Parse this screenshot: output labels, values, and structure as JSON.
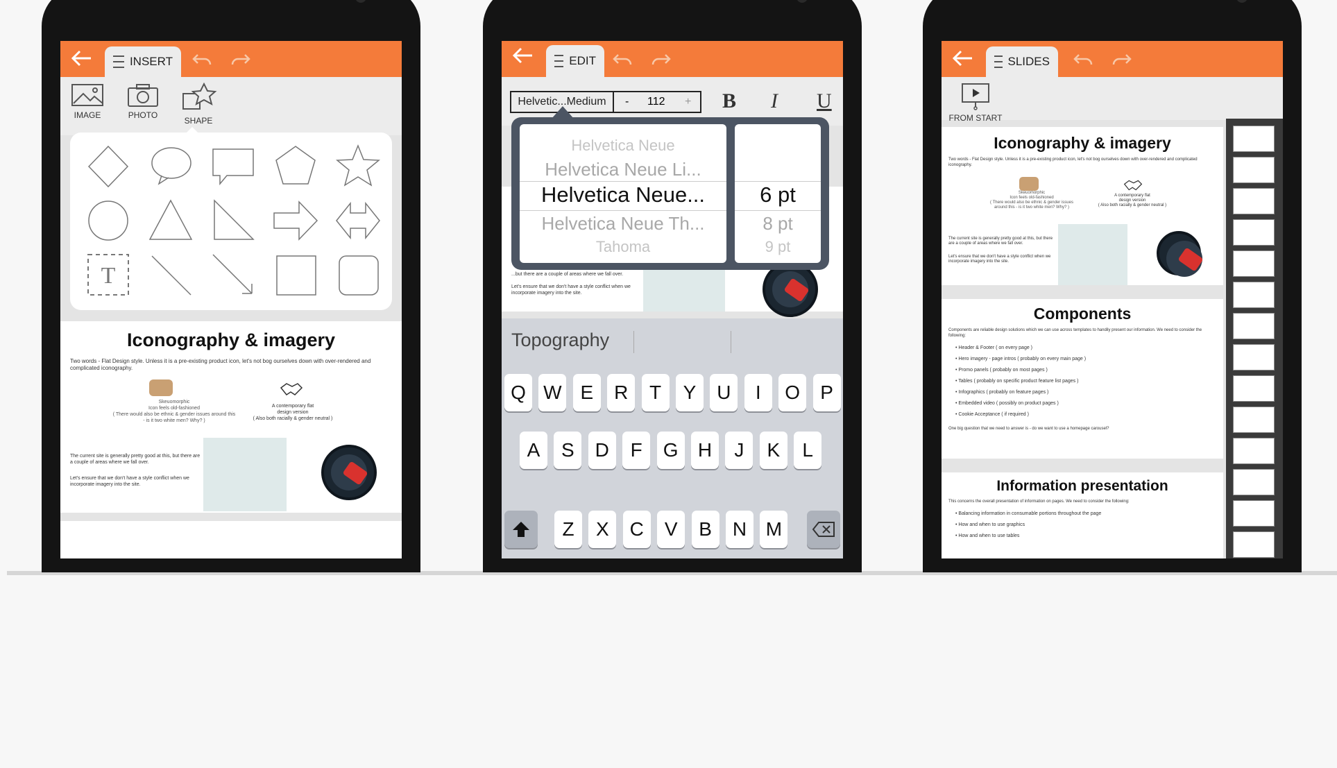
{
  "colors": {
    "accent": "#f47b3a",
    "background": "#f7f7f7",
    "phone_body": "#141414"
  },
  "phones": [
    {
      "tab_label": "INSERT",
      "tools": [
        "IMAGE",
        "PHOTO",
        "SHAPE"
      ],
      "shapes_panel": {
        "shapes": [
          "diamond",
          "speech-bubble",
          "callout",
          "pentagon",
          "star",
          "circle",
          "triangle",
          "right-triangle",
          "arrow-right",
          "double-arrow",
          "text-box",
          "line",
          "line-arrow",
          "square",
          "rounded-square"
        ],
        "text_box_glyph": "T"
      },
      "slide": {
        "title": "Iconography & imagery",
        "intro": "Two words - Flat Design style. Unless it is a pre-existing product icon, let's not bog ourselves down with over-rendered and complicated iconography.",
        "left_caption": "Skeuomorphic\nIcon feels old-fashioned\n( There would also be ethnic & gender issues around this - is it two white men? Why? )",
        "right_caption": "A contemporary flat\ndesign version\n( Also both racially & gender neutral )",
        "note1": "The current site is generally pretty good at this, but there are a couple of areas where we fall over.",
        "note2": "Let's ensure that we don't have a style conflict when we incorporate imagery into the site."
      }
    },
    {
      "tab_label": "EDIT",
      "font_field": "Helvetic...Medium",
      "size_minus": "-",
      "size_value": "112",
      "size_plus": "+",
      "bold": "B",
      "italic": "I",
      "underline": "U",
      "font_wheel": [
        "Helvetica Neue",
        "Helvetica Neue Li...",
        "Helvetica Neue...",
        "Helvetica Neue Th...",
        "Tahoma"
      ],
      "size_wheel": [
        "6 pt",
        "8 pt",
        "9 pt"
      ],
      "slide_note1": "...but there are a couple of areas where we fall over.",
      "slide_note2": "Let's ensure that we don't have a style conflict when we incorporate imagery into the site.",
      "suggestion": "Topography",
      "keyboard": {
        "row1": [
          "Q",
          "W",
          "E",
          "R",
          "T",
          "Y",
          "U",
          "I",
          "O",
          "P"
        ],
        "row2": [
          "A",
          "S",
          "D",
          "F",
          "G",
          "H",
          "J",
          "K",
          "L"
        ],
        "row3": [
          "Z",
          "X",
          "C",
          "V",
          "B",
          "N",
          "M"
        ]
      }
    },
    {
      "tab_label": "SLIDES",
      "tool": "FROM START",
      "slides": [
        {
          "title": "Iconography & imagery",
          "intro": "Two words - Flat Design style. Unless it is a pre-existing product icon, let's not bog ourselves down with over-rendered and complicated iconography.",
          "left_caption": "Skeuomorphic\nIcon feels old-fashioned\n( There would also be ethnic & gender issues around this - is it two white men? Why? )",
          "right_caption": "A contemporary flat\ndesign version\n( Also both racially & gender neutral )",
          "note1": "The current site is generally pretty good at this, but there are a couple of areas where we fall over.",
          "note2": "Let's ensure that we don't have a style conflict when we incorporate imagery into the site."
        },
        {
          "title": "Components",
          "intro": "Components are reliable design solutions which we can use across templates to handily present our information. We need to consider the following:",
          "bullets": [
            "Header & Footer ( on every page )",
            "Hero imagery - page intros ( probably on every main page )",
            "Promo panels ( probably on most pages )",
            "Tables ( probably on specific product feature list pages )",
            "Infographics ( probably on feature pages )",
            "Embedded video ( possibly on product pages )",
            "Cookie Acceptance ( if required )"
          ],
          "question": "One big question that we need to answer is - do we want to use a homepage carousel?"
        },
        {
          "title": "Information presentation",
          "intro": "This concerns the overall presentation of information on pages. We need to consider the following:",
          "bullets": [
            "Balancing information in consumable portions throughout the page",
            "How and when to use graphics",
            "How and when to use tables"
          ]
        }
      ]
    }
  ]
}
